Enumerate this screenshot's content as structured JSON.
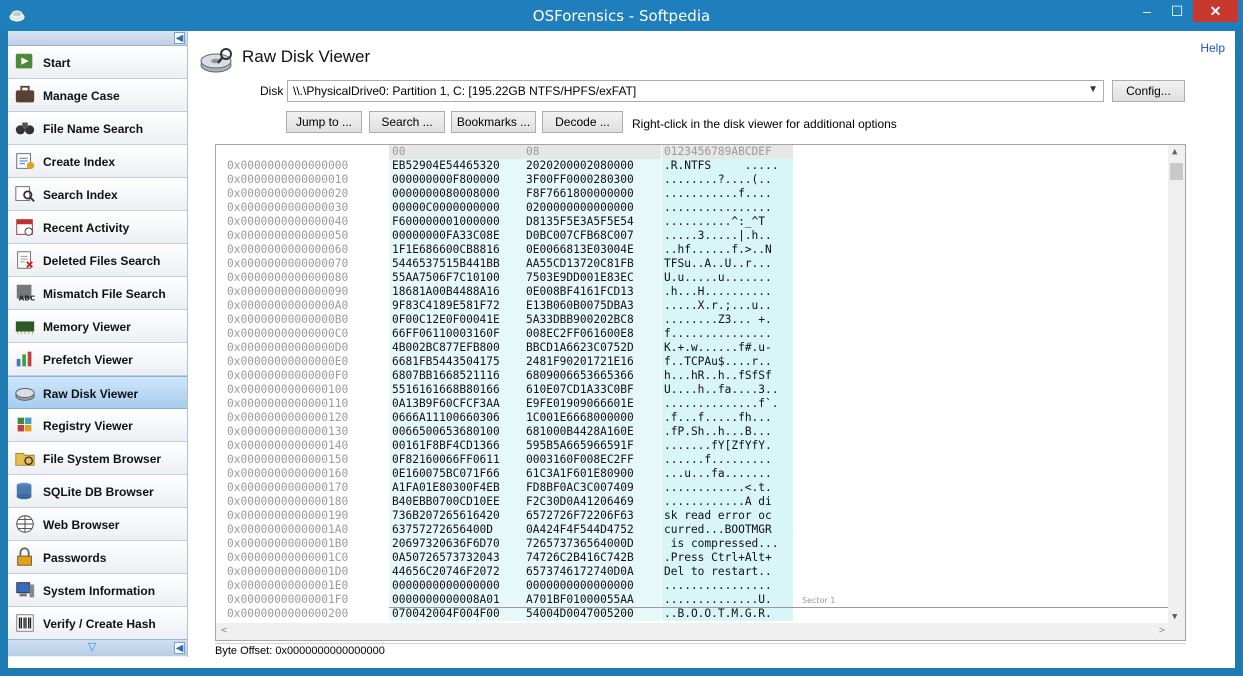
{
  "window": {
    "title": "OSForensics - Softpedia",
    "minimize": "–",
    "maximize": "☐",
    "close": "✕"
  },
  "sidebar": {
    "items": [
      {
        "label": "Start",
        "icon": "start-icon"
      },
      {
        "label": "Manage Case",
        "icon": "briefcase-icon"
      },
      {
        "label": "File Name Search",
        "icon": "binoculars-icon"
      },
      {
        "label": "Create Index",
        "icon": "create-index-icon"
      },
      {
        "label": "Search Index",
        "icon": "search-index-icon"
      },
      {
        "label": "Recent Activity",
        "icon": "calendar-icon"
      },
      {
        "label": "Deleted Files Search",
        "icon": "deleted-files-icon"
      },
      {
        "label": "Mismatch File Search",
        "icon": "mismatch-icon"
      },
      {
        "label": "Memory Viewer",
        "icon": "memory-icon"
      },
      {
        "label": "Prefetch Viewer",
        "icon": "prefetch-chart-icon"
      },
      {
        "label": "Raw Disk Viewer",
        "icon": "raw-disk-icon"
      },
      {
        "label": "Registry Viewer",
        "icon": "registry-icon"
      },
      {
        "label": "File System Browser",
        "icon": "folder-icon"
      },
      {
        "label": "SQLite DB Browser",
        "icon": "database-icon"
      },
      {
        "label": "Web Browser",
        "icon": "web-browser-icon"
      },
      {
        "label": "Passwords",
        "icon": "lock-icon"
      },
      {
        "label": "System Information",
        "icon": "system-info-icon"
      },
      {
        "label": "Verify / Create Hash",
        "icon": "barcode-icon"
      }
    ],
    "active_index": 10
  },
  "page": {
    "title": "Raw Disk Viewer",
    "help": "Help",
    "disk_label": "Disk",
    "disk_value": "\\\\.\\PhysicalDrive0: Partition 1, C: [195.22GB NTFS/HPFS/exFAT]",
    "config_button": "Config...",
    "jump_button": "Jump to ...",
    "search_button": "Search ...",
    "bookmarks_button": "Bookmarks ...",
    "decode_button": "Decode ...",
    "hint": "Right-click in the disk viewer for additional options"
  },
  "hex": {
    "header_hex1": "00",
    "header_hex2": "08",
    "header_ascii": "0123456789ABCDEF",
    "sector_label": "Sector 1",
    "rows": [
      {
        "offset": "0x0000000000000000",
        "h1": "EB52904E54465320",
        "h2": "2020200002080000",
        "a": ".R.NTFS     ....."
      },
      {
        "offset": "0x0000000000000010",
        "h1": "000000000F800000",
        "h2": "3F00FF0000280300",
        "a": "........?....(.."
      },
      {
        "offset": "0x0000000000000020",
        "h1": "0000000080008000",
        "h2": "F8F7661800000000",
        "a": "...........f...."
      },
      {
        "offset": "0x0000000000000030",
        "h1": "00000C0000000000",
        "h2": "0200000000000000",
        "a": "................"
      },
      {
        "offset": "0x0000000000000040",
        "h1": "F600000001000000",
        "h2": "D8135F5E3A5F5E54",
        "a": "..........^:_^T"
      },
      {
        "offset": "0x0000000000000050",
        "h1": "00000000FA33C08E",
        "h2": "D0BC007CFB68C007",
        "a": ".....3.....|.h.."
      },
      {
        "offset": "0x0000000000000060",
        "h1": "1F1E686600CB8816",
        "h2": "0E0066813E03004E",
        "a": "..hf......f.>..N"
      },
      {
        "offset": "0x0000000000000070",
        "h1": "5446537515B441BB",
        "h2": "AA55CD13720C81FB",
        "a": "TFSu..A..U..r..."
      },
      {
        "offset": "0x0000000000000080",
        "h1": "55AA7506F7C10100",
        "h2": "7503E9DD001E83EC",
        "a": "U.u.....u......."
      },
      {
        "offset": "0x0000000000000090",
        "h1": "18681A00B4488A16",
        "h2": "0E008BF4161FCD13",
        "a": ".h...H.........."
      },
      {
        "offset": "0x00000000000000A0",
        "h1": "9F83C4189E581F72",
        "h2": "E13B060B0075DBA3",
        "a": ".....X.r.;...u.."
      },
      {
        "offset": "0x00000000000000B0",
        "h1": "0F00C12E0F00041E",
        "h2": "5A33DBB900202BC8",
        "a": "........Z3... +."
      },
      {
        "offset": "0x00000000000000C0",
        "h1": "66FF06110003160F",
        "h2": "008EC2FF061600E8",
        "a": "f..............."
      },
      {
        "offset": "0x00000000000000D0",
        "h1": "4B002BC877EFB800",
        "h2": "BBCD1A6623C0752D",
        "a": "K.+.w......f#.u-"
      },
      {
        "offset": "0x00000000000000E0",
        "h1": "6681FB5443504175",
        "h2": "2481F90201721E16",
        "a": "f..TCPAu$....r.."
      },
      {
        "offset": "0x00000000000000F0",
        "h1": "6807BB1668521116",
        "h2": "6809006653665366",
        "a": "h...hR..h..fSfSf"
      },
      {
        "offset": "0x0000000000000100",
        "h1": "5516161668B80166",
        "h2": "610E07CD1A33C0BF",
        "a": "U....h..fa....3.."
      },
      {
        "offset": "0x0000000000000110",
        "h1": "0A13B9F60CFCF3AA",
        "h2": "E9FE01909066601E",
        "a": "..............f`."
      },
      {
        "offset": "0x0000000000000120",
        "h1": "0666A11100660306",
        "h2": "1C001E6668000000",
        "a": ".f...f.....fh..."
      },
      {
        "offset": "0x0000000000000130",
        "h1": "0066500653680100",
        "h2": "681000B4428A160E",
        "a": ".fP.Sh..h...B..."
      },
      {
        "offset": "0x0000000000000140",
        "h1": "00161F8BF4CD1366",
        "h2": "595B5A665966591F",
        "a": ".......fY[ZfYfY."
      },
      {
        "offset": "0x0000000000000150",
        "h1": "0F82160066FF0611",
        "h2": "0003160F008EC2FF",
        "a": "......f........."
      },
      {
        "offset": "0x0000000000000160",
        "h1": "0E160075BC071F66",
        "h2": "61C3A1F601E80900",
        "a": "...u...fa......."
      },
      {
        "offset": "0x0000000000000170",
        "h1": "A1FA01E80300F4EB",
        "h2": "FD8BF0AC3C007409",
        "a": "............<.t."
      },
      {
        "offset": "0x0000000000000180",
        "h1": "B40EBB0700CD10EE",
        "h2": "F2C30D0A41206469",
        "a": "............A di"
      },
      {
        "offset": "0x0000000000000190",
        "h1": "736B207265616420",
        "h2": "6572726F72206F63",
        "a": "sk read error oc"
      },
      {
        "offset": "0x00000000000001A0",
        "h1": "63757272656400D",
        "h2": "0A424F4F544D4752",
        "a": "curred...BOOTMGR"
      },
      {
        "offset": "0x00000000000001B0",
        "h1": "20697320636F6D70",
        "h2": "726573736564000D",
        "a": " is compressed..."
      },
      {
        "offset": "0x00000000000001C0",
        "h1": "0A50726573732043",
        "h2": "74726C2B416C742B",
        "a": ".Press Ctrl+Alt+"
      },
      {
        "offset": "0x00000000000001D0",
        "h1": "44656C20746F2072",
        "h2": "6573746172740D0A",
        "a": "Del to restart.."
      },
      {
        "offset": "0x00000000000001E0",
        "h1": "0000000000000000",
        "h2": "0000000000000000",
        "a": "................"
      },
      {
        "offset": "0x00000000000001F0",
        "h1": "0000000000008A01",
        "h2": "A701BF01000055AA",
        "a": "..............U."
      },
      {
        "offset": "0x0000000000000200",
        "h1": "070042004F004F00",
        "h2": "54004D0047005200",
        "a": "..B.O.O.T.M.G.R."
      }
    ]
  },
  "status": {
    "byte_offset": "Byte Offset: 0x0000000000000000"
  }
}
